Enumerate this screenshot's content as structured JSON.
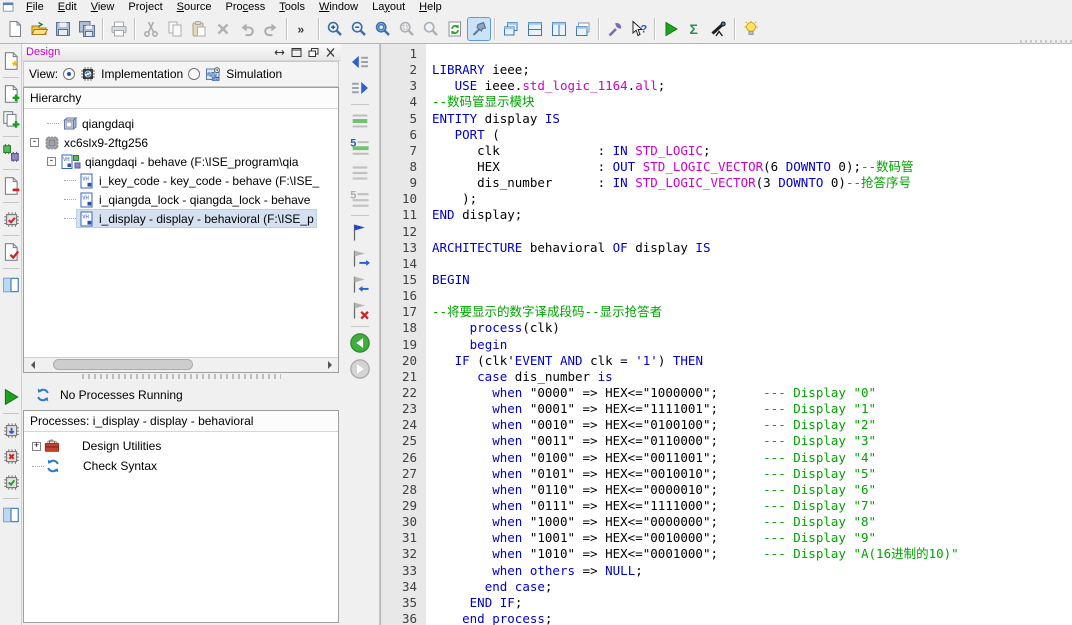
{
  "colors": {
    "keyword": "#0000cc",
    "type": "#cc00cc",
    "comment": "#00a300",
    "plain": "#000000",
    "selection": "#d4e1f1",
    "accent": "#3c78b4"
  },
  "window": {
    "menu": [
      {
        "label": "File",
        "u": 0
      },
      {
        "label": "Edit",
        "u": 0
      },
      {
        "label": "View",
        "u": 0
      },
      {
        "label": "Project",
        "u": 3
      },
      {
        "label": "Source",
        "u": 0
      },
      {
        "label": "Process",
        "u": 3
      },
      {
        "label": "Tools",
        "u": 0
      },
      {
        "label": "Window",
        "u": 0
      },
      {
        "label": "Layout",
        "u": 2
      },
      {
        "label": "Help",
        "u": 0
      }
    ]
  },
  "toolbar": {
    "groups": [
      [
        {
          "name": "new-document"
        },
        {
          "name": "open-project"
        },
        {
          "name": "save"
        },
        {
          "name": "save-all"
        }
      ],
      [
        {
          "name": "print",
          "disabled": true
        }
      ],
      [
        {
          "name": "cut",
          "disabled": true
        },
        {
          "name": "copy",
          "disabled": true
        },
        {
          "name": "paste",
          "disabled": true
        },
        {
          "name": "delete-item",
          "disabled": true
        },
        {
          "name": "undo",
          "disabled": true
        },
        {
          "name": "redo",
          "disabled": true
        }
      ],
      [
        {
          "name": "toolbar-overflow"
        }
      ],
      [
        {
          "name": "zoom-in"
        },
        {
          "name": "zoom-out"
        },
        {
          "name": "zoom-full"
        },
        {
          "name": "zoom-region",
          "disabled": true
        },
        {
          "name": "zoom-point",
          "disabled": true
        },
        {
          "name": "refresh-view"
        },
        {
          "name": "pan-tool",
          "active": true
        }
      ],
      [
        {
          "name": "cascade-windows"
        },
        {
          "name": "tile-horizontal"
        },
        {
          "name": "tile-vertical"
        },
        {
          "name": "arrange-windows"
        }
      ],
      [
        {
          "name": "wrench-tool"
        },
        {
          "name": "context-help"
        }
      ],
      [
        {
          "name": "run-process"
        },
        {
          "name": "run-simulation"
        },
        {
          "name": "analyze-design"
        }
      ],
      [
        {
          "name": "show-tip"
        }
      ]
    ]
  },
  "left_rail": {
    "top": [
      [
        "new-source"
      ],
      [
        "add-source",
        "add-copy-source"
      ],
      [
        "new-partition"
      ],
      [
        "remove-source"
      ],
      [
        "device-check"
      ],
      [
        "check-doc"
      ],
      [
        "columns-view"
      ]
    ],
    "bottom": [
      [
        "run-process"
      ],
      [
        "rerun-process",
        "stop-process",
        "rerun-all"
      ],
      [
        "columns-view"
      ]
    ]
  },
  "mid_rail": [
    [
      "shift-left",
      "shift-right"
    ],
    [
      "highlight-lines",
      "goto-line",
      "highlight-lines-off",
      "goto-line-off"
    ],
    [
      "toggle-bookmark",
      "next-bookmark",
      "prev-bookmark",
      "clear-bookmarks"
    ],
    [
      "nav-back",
      "nav-forward"
    ]
  ],
  "design": {
    "title": "Design",
    "view_label": "View:",
    "views": [
      {
        "label": "Implementation",
        "icon": "implementation",
        "selected": true
      },
      {
        "label": "Simulation",
        "icon": "simulation",
        "selected": false
      }
    ],
    "hierarchy": {
      "header": "Hierarchy",
      "rows": [
        {
          "label": "qiangdaqi",
          "icon": "project",
          "indent": 1
        },
        {
          "label": "xc6slx9-2ftg256",
          "icon": "device",
          "indent": 0,
          "expand": "-"
        },
        {
          "label": "qiangdaqi - behave (F:\\ISE_program\\qia",
          "icon": "top-module",
          "indent": 1,
          "expand": "-"
        },
        {
          "label": "i_key_code - key_code - behave (F:\\ISE_",
          "icon": "vhdl-module",
          "indent": 2
        },
        {
          "label": "i_qiangda_lock - qiangda_lock - behave",
          "icon": "vhdl-module",
          "indent": 2
        },
        {
          "label": "i_display - display - behavioral (F:\\ISE_p",
          "icon": "vhdl-module",
          "indent": 2,
          "selected": true
        }
      ]
    },
    "status": {
      "icon": "sync",
      "label": "No Processes Running"
    },
    "processes": {
      "header": "Processes: i_display - display - behavioral",
      "rows": [
        {
          "label": "Design Utilities",
          "icon": "toolbox",
          "expand": "+"
        },
        {
          "label": "Check Syntax",
          "icon": "sync"
        }
      ]
    }
  },
  "editor": {
    "lines": [
      {
        "n": 1,
        "s": []
      },
      {
        "n": 2,
        "s": [
          [
            "k",
            "LIBRARY"
          ],
          [
            "p",
            " ieee;"
          ]
        ]
      },
      {
        "n": 3,
        "s": [
          [
            "p",
            "   "
          ],
          [
            "k",
            "USE"
          ],
          [
            "p",
            " ieee."
          ],
          [
            "t",
            "std_logic_1164"
          ],
          [
            "p",
            "."
          ],
          [
            "t",
            "all"
          ],
          [
            "p",
            ";"
          ]
        ]
      },
      {
        "n": 4,
        "s": [
          [
            "c",
            "--数码管显示模块"
          ]
        ]
      },
      {
        "n": 5,
        "s": [
          [
            "k",
            "ENTITY"
          ],
          [
            "p",
            " display "
          ],
          [
            "k",
            "IS"
          ]
        ]
      },
      {
        "n": 6,
        "s": [
          [
            "p",
            "   "
          ],
          [
            "k",
            "PORT"
          ],
          [
            "p",
            " ("
          ]
        ]
      },
      {
        "n": 7,
        "s": [
          [
            "p",
            "      clk             : "
          ],
          [
            "k",
            "IN"
          ],
          [
            "p",
            " "
          ],
          [
            "t",
            "STD_LOGIC"
          ],
          [
            "p",
            ";"
          ]
        ]
      },
      {
        "n": 8,
        "s": [
          [
            "p",
            "      HEX             : "
          ],
          [
            "k",
            "OUT"
          ],
          [
            "p",
            " "
          ],
          [
            "t",
            "STD_LOGIC_VECTOR"
          ],
          [
            "p",
            "(6 "
          ],
          [
            "k",
            "DOWNTO"
          ],
          [
            "p",
            " 0);"
          ],
          [
            "c",
            "--数码管"
          ]
        ]
      },
      {
        "n": 9,
        "s": [
          [
            "p",
            "      dis_number      : "
          ],
          [
            "k",
            "IN"
          ],
          [
            "p",
            " "
          ],
          [
            "t",
            "STD_LOGIC_VECTOR"
          ],
          [
            "p",
            "(3 "
          ],
          [
            "k",
            "DOWNTO"
          ],
          [
            "p",
            " 0)"
          ],
          [
            "c",
            "--抢答序号"
          ]
        ]
      },
      {
        "n": 10,
        "s": [
          [
            "p",
            "    );"
          ]
        ]
      },
      {
        "n": 11,
        "s": [
          [
            "k",
            "END"
          ],
          [
            "p",
            " display;"
          ]
        ]
      },
      {
        "n": 12,
        "s": []
      },
      {
        "n": 13,
        "s": [
          [
            "k",
            "ARCHITECTURE"
          ],
          [
            "p",
            " behavioral "
          ],
          [
            "k",
            "OF"
          ],
          [
            "p",
            " display "
          ],
          [
            "k",
            "IS"
          ]
        ]
      },
      {
        "n": 14,
        "s": []
      },
      {
        "n": 15,
        "s": [
          [
            "k",
            "BEGIN"
          ]
        ]
      },
      {
        "n": 16,
        "s": []
      },
      {
        "n": 17,
        "s": [
          [
            "c",
            "--将要显示的数字译成段码--显示抢答者"
          ]
        ]
      },
      {
        "n": 18,
        "s": [
          [
            "p",
            "     "
          ],
          [
            "k",
            "process"
          ],
          [
            "p",
            "(clk)"
          ]
        ]
      },
      {
        "n": 19,
        "s": [
          [
            "p",
            "     "
          ],
          [
            "k",
            "begin"
          ]
        ]
      },
      {
        "n": 20,
        "s": [
          [
            "p",
            "   "
          ],
          [
            "k",
            "IF"
          ],
          [
            "p",
            " (clk'"
          ],
          [
            "k",
            "EVENT"
          ],
          [
            "p",
            " "
          ],
          [
            "k",
            "AND"
          ],
          [
            "p",
            " clk = "
          ],
          [
            "k",
            "'1'"
          ],
          [
            "p",
            ") "
          ],
          [
            "k",
            "THEN"
          ]
        ]
      },
      {
        "n": 21,
        "s": [
          [
            "p",
            "      "
          ],
          [
            "k",
            "case"
          ],
          [
            "p",
            " dis_number "
          ],
          [
            "k",
            "is"
          ]
        ]
      },
      {
        "n": 22,
        "s": [
          [
            "p",
            "        "
          ],
          [
            "k",
            "when"
          ],
          [
            "p",
            " \"0000\" => HEX<=\"1000000\";      "
          ],
          [
            "c",
            "--- Display \"0\""
          ]
        ]
      },
      {
        "n": 23,
        "s": [
          [
            "p",
            "        "
          ],
          [
            "k",
            "when"
          ],
          [
            "p",
            " \"0001\" => HEX<=\"1111001\";      "
          ],
          [
            "c",
            "--- Display \"1\""
          ]
        ]
      },
      {
        "n": 24,
        "s": [
          [
            "p",
            "        "
          ],
          [
            "k",
            "when"
          ],
          [
            "p",
            " \"0010\" => HEX<=\"0100100\";      "
          ],
          [
            "c",
            "--- Display \"2\""
          ]
        ]
      },
      {
        "n": 25,
        "s": [
          [
            "p",
            "        "
          ],
          [
            "k",
            "when"
          ],
          [
            "p",
            " \"0011\" => HEX<=\"0110000\";      "
          ],
          [
            "c",
            "--- Display \"3\""
          ]
        ]
      },
      {
        "n": 26,
        "s": [
          [
            "p",
            "        "
          ],
          [
            "k",
            "when"
          ],
          [
            "p",
            " \"0100\" => HEX<=\"0011001\";      "
          ],
          [
            "c",
            "--- Display \"4\""
          ]
        ]
      },
      {
        "n": 27,
        "s": [
          [
            "p",
            "        "
          ],
          [
            "k",
            "when"
          ],
          [
            "p",
            " \"0101\" => HEX<=\"0010010\";      "
          ],
          [
            "c",
            "--- Display \"5\""
          ]
        ]
      },
      {
        "n": 28,
        "s": [
          [
            "p",
            "        "
          ],
          [
            "k",
            "when"
          ],
          [
            "p",
            " \"0110\" => HEX<=\"0000010\";      "
          ],
          [
            "c",
            "--- Display \"6\""
          ]
        ]
      },
      {
        "n": 29,
        "s": [
          [
            "p",
            "        "
          ],
          [
            "k",
            "when"
          ],
          [
            "p",
            " \"0111\" => HEX<=\"1111000\";      "
          ],
          [
            "c",
            "--- Display \"7\""
          ]
        ]
      },
      {
        "n": 30,
        "s": [
          [
            "p",
            "        "
          ],
          [
            "k",
            "when"
          ],
          [
            "p",
            " \"1000\" => HEX<=\"0000000\";      "
          ],
          [
            "c",
            "--- Display \"8\""
          ]
        ]
      },
      {
        "n": 31,
        "s": [
          [
            "p",
            "        "
          ],
          [
            "k",
            "when"
          ],
          [
            "p",
            " \"1001\" => HEX<=\"0010000\";      "
          ],
          [
            "c",
            "--- Display \"9\""
          ]
        ]
      },
      {
        "n": 32,
        "s": [
          [
            "p",
            "        "
          ],
          [
            "k",
            "when"
          ],
          [
            "p",
            " \"1010\" => HEX<=\"0001000\";      "
          ],
          [
            "c",
            "--- Display \"A(16进制的10)\""
          ]
        ]
      },
      {
        "n": 33,
        "s": [
          [
            "p",
            "        "
          ],
          [
            "k",
            "when"
          ],
          [
            "p",
            " "
          ],
          [
            "k",
            "others"
          ],
          [
            "p",
            " => "
          ],
          [
            "k",
            "NULL"
          ],
          [
            "p",
            ";"
          ]
        ]
      },
      {
        "n": 34,
        "s": [
          [
            "p",
            "       "
          ],
          [
            "k",
            "end"
          ],
          [
            "p",
            " "
          ],
          [
            "k",
            "case"
          ],
          [
            "p",
            ";"
          ]
        ]
      },
      {
        "n": 35,
        "s": [
          [
            "p",
            "     "
          ],
          [
            "k",
            "END"
          ],
          [
            "p",
            " "
          ],
          [
            "k",
            "IF"
          ],
          [
            "p",
            ";"
          ]
        ]
      },
      {
        "n": 36,
        "s": [
          [
            "p",
            "    "
          ],
          [
            "k",
            "end"
          ],
          [
            "p",
            " "
          ],
          [
            "k",
            "process"
          ],
          [
            "p",
            ";"
          ]
        ]
      }
    ]
  }
}
